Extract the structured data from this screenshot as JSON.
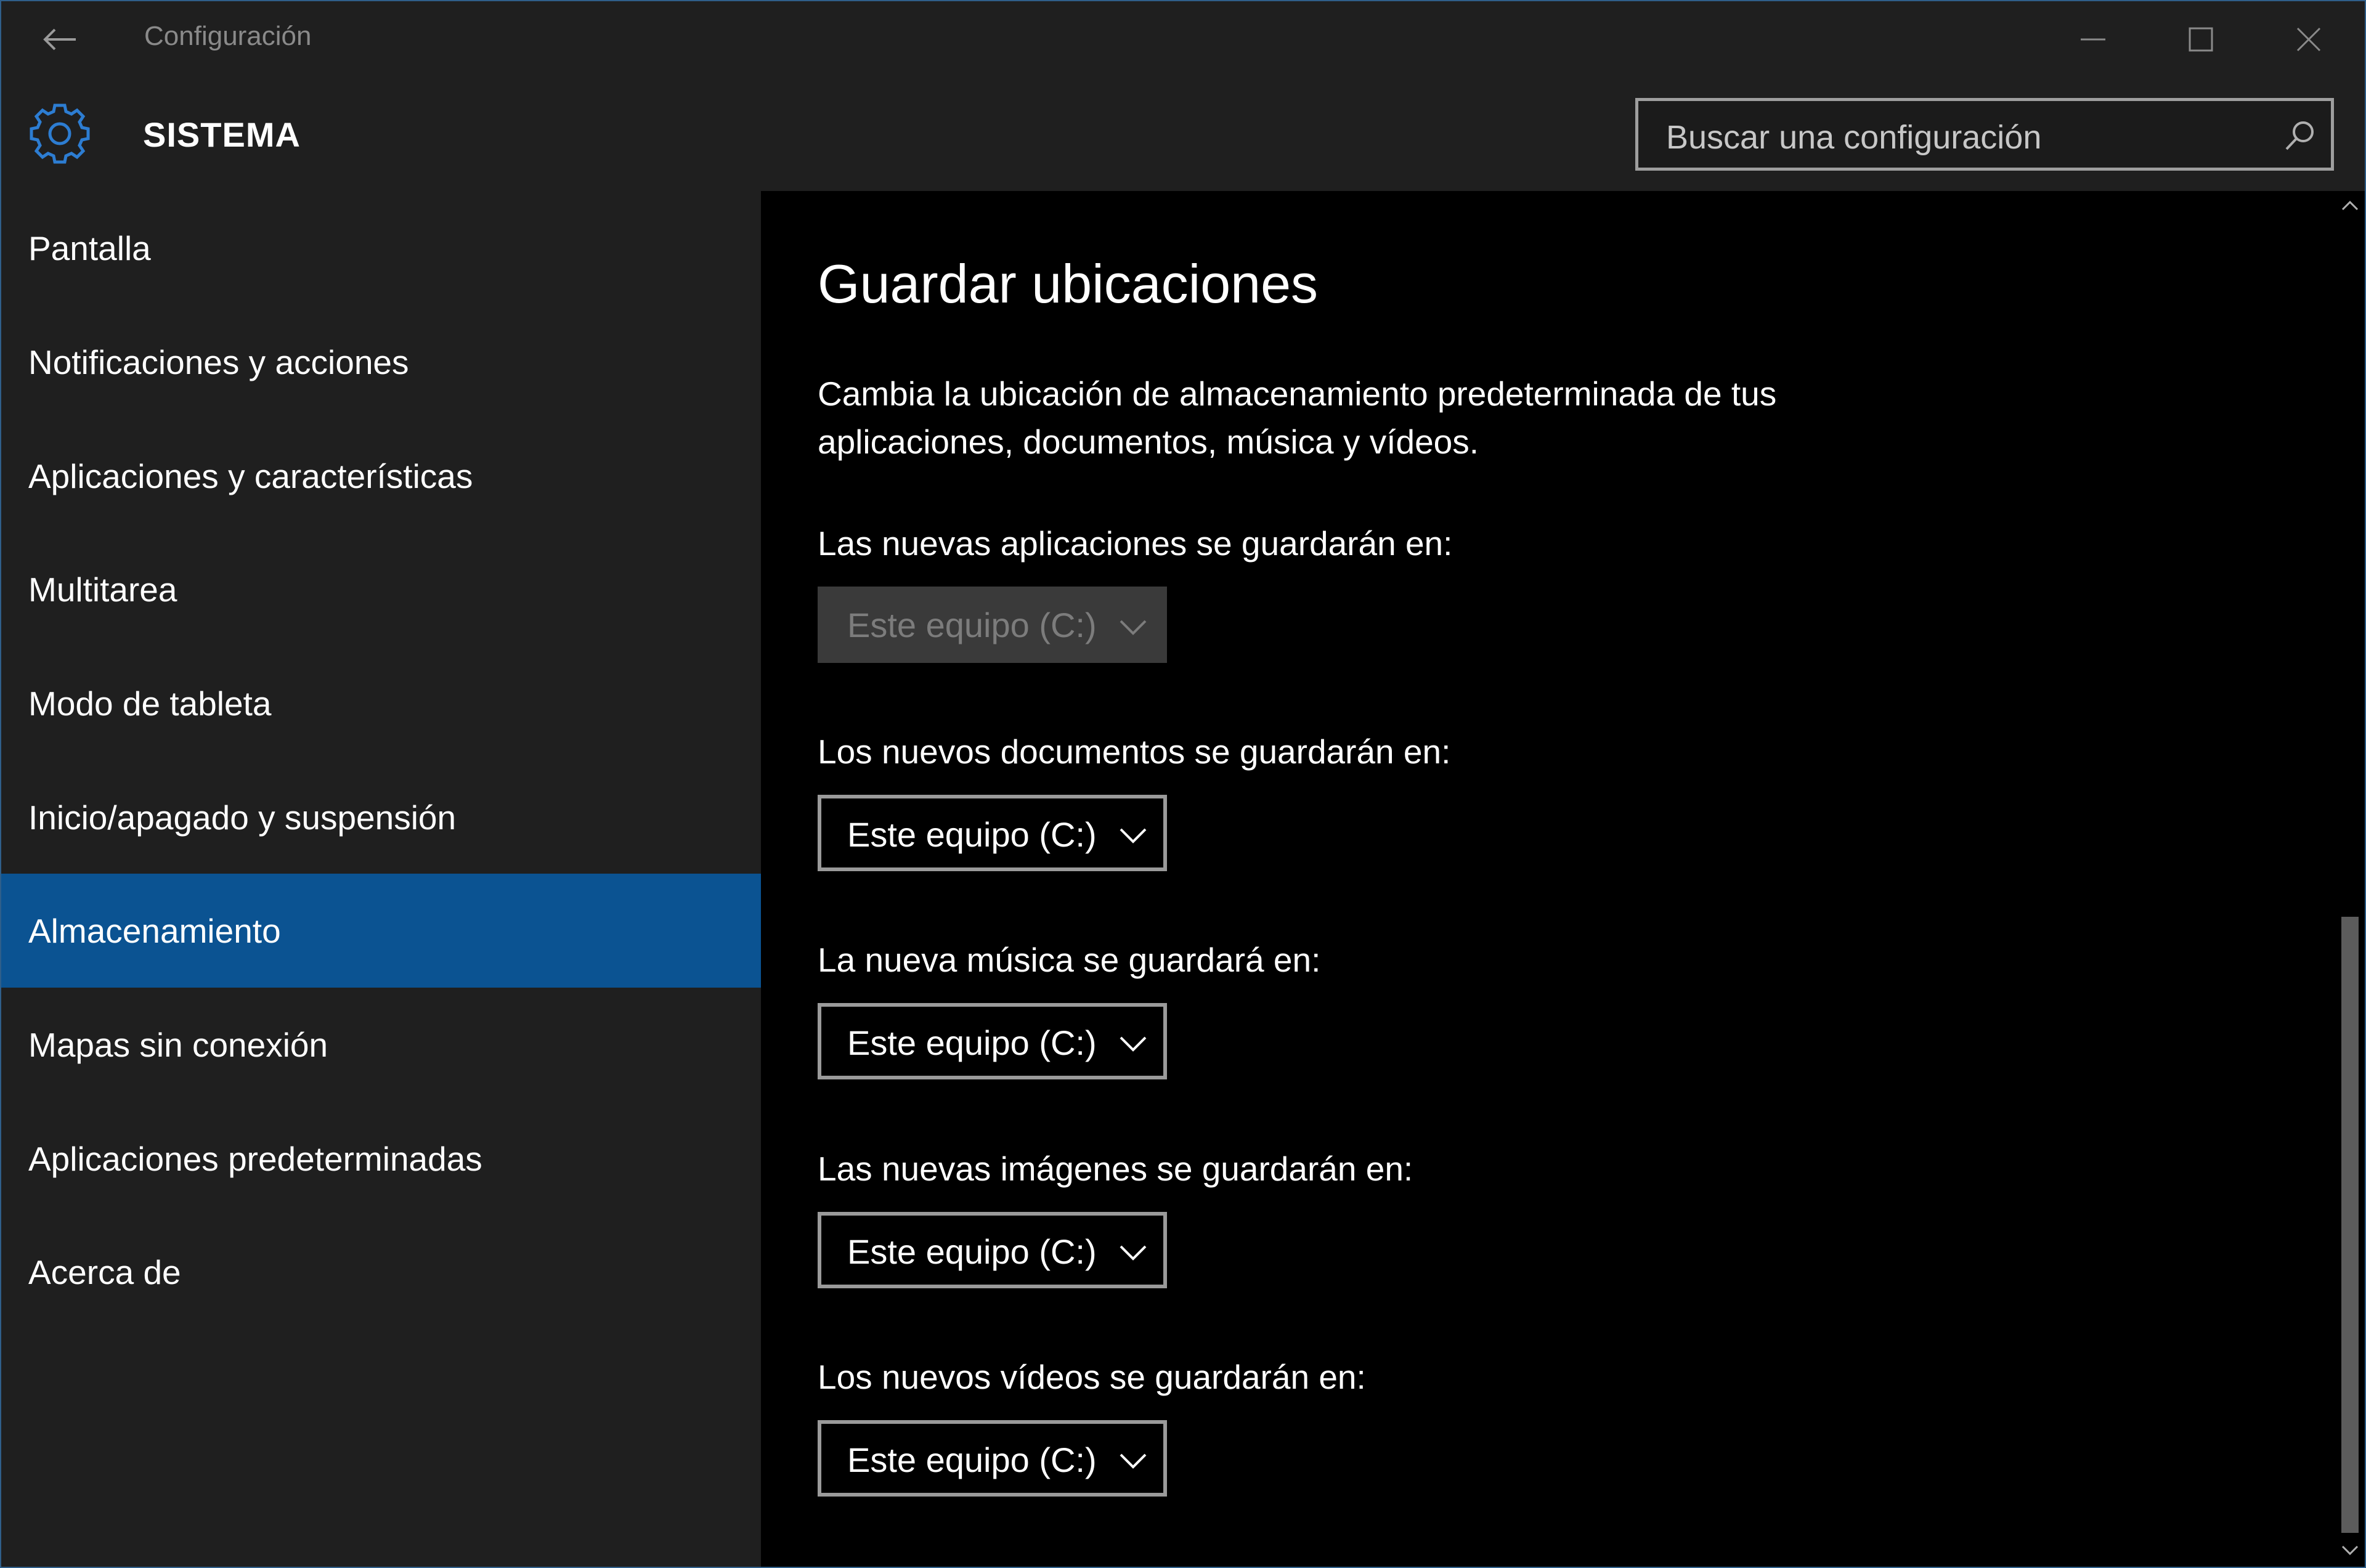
{
  "window": {
    "title": "Configuración"
  },
  "header": {
    "section_title": "SISTEMA",
    "search_placeholder": "Buscar una configuración"
  },
  "sidebar": {
    "items": [
      {
        "label": "Pantalla"
      },
      {
        "label": "Notificaciones y acciones"
      },
      {
        "label": "Aplicaciones y características"
      },
      {
        "label": "Multitarea"
      },
      {
        "label": "Modo de tableta"
      },
      {
        "label": "Inicio/apagado y suspensión"
      },
      {
        "label": "Almacenamiento",
        "selected": true
      },
      {
        "label": "Mapas sin conexión"
      },
      {
        "label": "Aplicaciones predeterminadas"
      },
      {
        "label": "Acerca de"
      }
    ]
  },
  "main": {
    "heading": "Guardar ubicaciones",
    "description_line1": "Cambia la ubicación de almacenamiento predeterminada de tus",
    "description_line2": "aplicaciones, documentos, música y vídeos.",
    "locations": [
      {
        "label": "Las nuevas aplicaciones se guardarán en:",
        "value": "Este equipo (C:)",
        "enabled": false
      },
      {
        "label": "Los nuevos documentos se guardarán en:",
        "value": "Este equipo (C:)",
        "enabled": true
      },
      {
        "label": "La nueva música se guardará en:",
        "value": "Este equipo (C:)",
        "enabled": true
      },
      {
        "label": "Las nuevas imágenes se guardarán en:",
        "value": "Este equipo (C:)",
        "enabled": true
      },
      {
        "label": "Los nuevos vídeos se guardarán en:",
        "value": "Este equipo (C:)",
        "enabled": true
      }
    ]
  },
  "colors": {
    "accent": "#0b5392",
    "accent_icon": "#2d7dd2",
    "chrome_bg": "#1f1f1f",
    "content_bg": "#000000"
  },
  "icons": {
    "back": "arrow-left-icon",
    "settings": "gear-icon",
    "search": "search-icon",
    "dropdown": "chevron-down-icon"
  }
}
